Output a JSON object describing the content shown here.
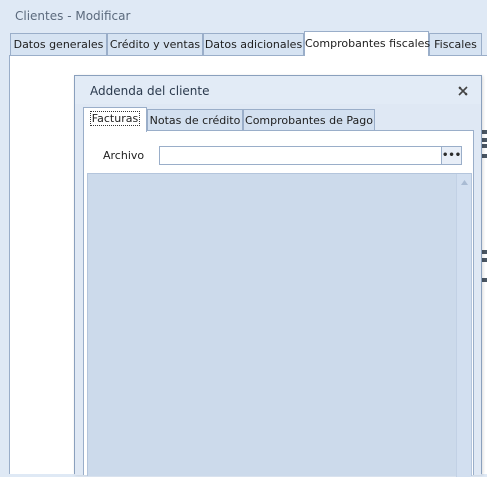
{
  "window": {
    "title": "Clientes - Modificar"
  },
  "outer_tabs": [
    {
      "label": "Datos generales"
    },
    {
      "label": "Crédito y ventas"
    },
    {
      "label": "Datos adicionales"
    },
    {
      "label": "Comprobantes fiscales",
      "active": true
    },
    {
      "label": "Fiscales"
    }
  ],
  "dialog": {
    "title": "Addenda del cliente",
    "close_icon": "close-icon",
    "tabs": [
      {
        "label": "Facturas",
        "active": true
      },
      {
        "label": "Notas de crédito"
      },
      {
        "label": "Comprobantes de Pago"
      }
    ],
    "archivo_label": "Archivo",
    "archivo_value": "",
    "browse_label": "•••"
  },
  "colors": {
    "background": "#dfe9f5",
    "tab_border": "#9aaec9",
    "list_area": "#ccdaeb"
  }
}
